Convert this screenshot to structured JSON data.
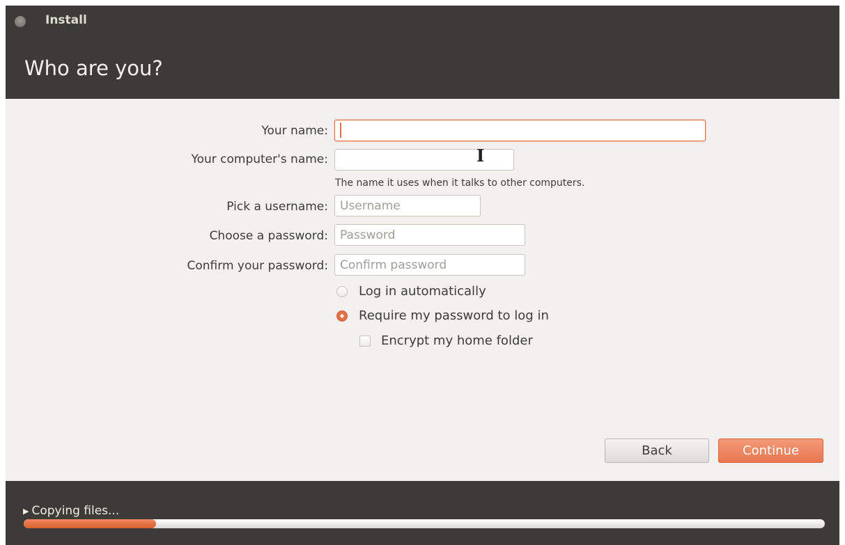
{
  "window": {
    "title": "Install"
  },
  "header": {
    "heading": "Who are you?"
  },
  "form": {
    "your_name": {
      "label": "Your name:",
      "value": "",
      "placeholder": ""
    },
    "computer_name": {
      "label": "Your computer's name:",
      "value": "",
      "placeholder": "",
      "hint": "The name it uses when it talks to other computers."
    },
    "username": {
      "label": "Pick a username:",
      "value": "",
      "placeholder": "Username"
    },
    "password": {
      "label": "Choose a password:",
      "value": "",
      "placeholder": "Password"
    },
    "confirm_password": {
      "label": "Confirm your password:",
      "value": "",
      "placeholder": "Confirm password"
    }
  },
  "options": {
    "login_automatically": {
      "label": "Log in automatically",
      "checked": false
    },
    "require_password": {
      "label": "Require my password to log in",
      "checked": true
    },
    "encrypt_home": {
      "label": "Encrypt my home folder",
      "checked": false
    }
  },
  "buttons": {
    "back": "Back",
    "continue": "Continue"
  },
  "status": {
    "text": "Copying files...",
    "progress": 0.165
  },
  "colors": {
    "accent": "#e2714a",
    "bar_background": "#3c3b37",
    "content_background": "#f2f1f0"
  }
}
